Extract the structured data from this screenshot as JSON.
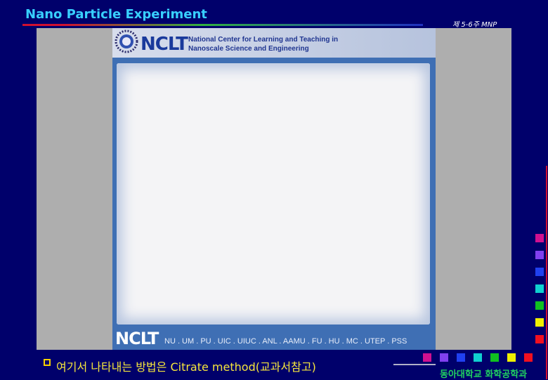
{
  "header": {
    "title": "Nano Particle Experiment",
    "chapter": "제 5-6주 MNP"
  },
  "embedded_page": {
    "logo_text": "NCLT",
    "center_name_line1": "National Center for Learning and Teaching in",
    "center_name_line2": "Nanoscale Science and Engineering",
    "footer_logo": "NCLT",
    "footer_partners": "NU . UM . PU . UIC . UIUC . ANL . AAMU . FU . HU . MC . UTEP . PSS"
  },
  "bullet": {
    "text": "여기서 나타내는 방법은 Citrate method(교과서참고)"
  },
  "university": {
    "name": "동아대학교 화학공학과"
  },
  "colors": {
    "background": "#00006b",
    "title": "#38d0ff",
    "bullet_text": "#f6e63c",
    "squares_bottom": [
      "#d01090",
      "#8040f0",
      "#2040f0",
      "#10d0d0",
      "#10c020",
      "#f0f000",
      "#f01020"
    ],
    "squares_side": [
      "#d01090",
      "#8040f0",
      "#2040f0",
      "#10d0d0",
      "#10c020",
      "#f0f000",
      "#f01020"
    ]
  }
}
